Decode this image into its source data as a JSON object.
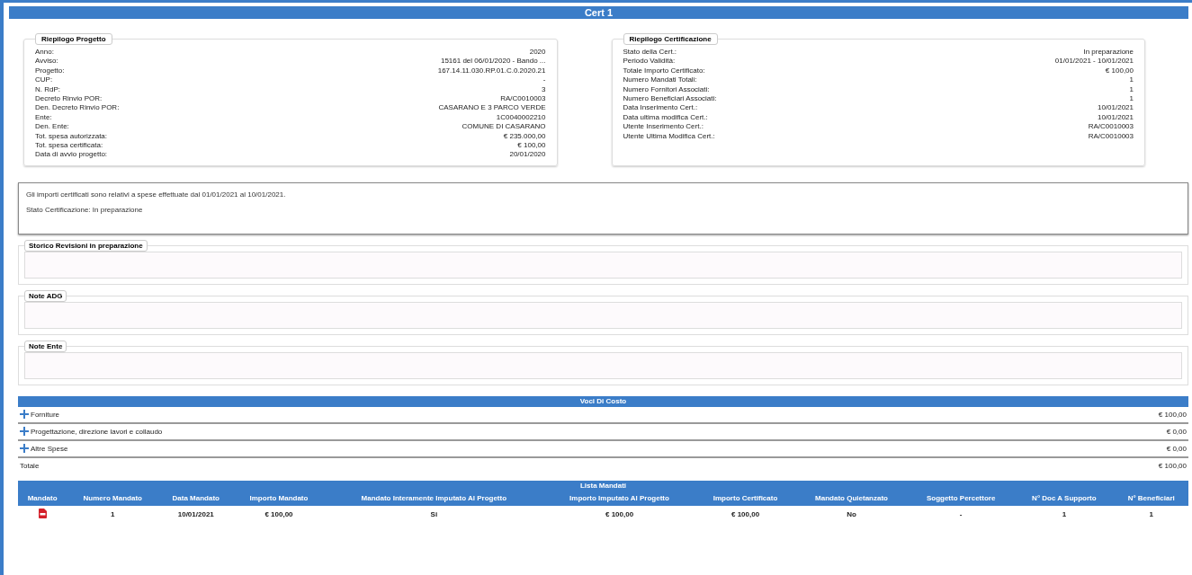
{
  "title": "Cert 1",
  "project_summary": {
    "legend": "Riepilogo Progetto",
    "rows": [
      {
        "label": "Anno:",
        "value": "2020"
      },
      {
        "label": "Avviso:",
        "value": "15161 del 06/01/2020 - Bando ..."
      },
      {
        "label": "Progetto:",
        "value": "167.14.11.030.RP.01.C.0.2020.21"
      },
      {
        "label": "CUP:",
        "value": "-"
      },
      {
        "label": "N. RdP:",
        "value": "3"
      },
      {
        "label": "Decreto Rinvio POR:",
        "value": "RA/C0010003"
      },
      {
        "label": "Den. Decreto Rinvio POR:",
        "value": "CASARANO E 3 PARCO VERDE"
      },
      {
        "label": "Ente:",
        "value": "1C0040002210"
      },
      {
        "label": "Den. Ente:",
        "value": "COMUNE DI CASARANO"
      },
      {
        "label": "Tot. spesa autorizzata:",
        "value": "€ 235.000,00"
      },
      {
        "label": "Tot. spesa certificata:",
        "value": "€ 100,00"
      },
      {
        "label": "Data di avvio progetto:",
        "value": "20/01/2020"
      }
    ]
  },
  "cert_summary": {
    "legend": "Riepilogo Certificazione",
    "rows": [
      {
        "label": "Stato della Cert.:",
        "value": "In preparazione"
      },
      {
        "label": "Periodo Validità:",
        "value": "01/01/2021 - 10/01/2021"
      },
      {
        "label": "Totale Importo Certificato:",
        "value": "€ 100,00"
      },
      {
        "label": "Numero Mandati Totali:",
        "value": "1"
      },
      {
        "label": "Numero Fornitori Associati:",
        "value": "1"
      },
      {
        "label": "Numero Beneficiari Associati:",
        "value": "1"
      },
      {
        "label": "Data Inserimento Cert.:",
        "value": "10/01/2021"
      },
      {
        "label": "Data ultima modifica Cert.:",
        "value": "10/01/2021"
      },
      {
        "label": "Utente Inserimento Cert.:",
        "value": "RA/C0010003"
      },
      {
        "label": "Utente Ultima Modifica Cert.:",
        "value": "RA/C0010003"
      }
    ]
  },
  "message": [
    "Gli importi certificati sono relativi a spese effettuate dal 01/01/2021 al 10/01/2021.",
    "Stato Certificazione: In preparazione"
  ],
  "note_fields": [
    {
      "legend": "Storico Revisioni in preparazione"
    },
    {
      "legend": "Note ADG"
    },
    {
      "legend": "Note Ente"
    }
  ],
  "cost_items": {
    "header": "Voci Di Costo",
    "rows": [
      {
        "label": "Forniture",
        "amount": "€ 100,00",
        "kind": "expandable"
      },
      {
        "label": "Progettazione, direzione lavori e collaudo",
        "amount": "€ 0,00",
        "kind": "expandable"
      },
      {
        "label": "Altre Spese",
        "amount": "€ 0,00",
        "kind": "expandable"
      },
      {
        "label": "Totale",
        "amount": "€ 100,00",
        "kind": "total"
      }
    ]
  },
  "mandates": {
    "header": "Lista Mandati",
    "columns": [
      "Mandato",
      "Numero Mandato",
      "Data Mandato",
      "Importo Mandato",
      "Mandato Interamente Imputato Al Progetto",
      "Importo Imputato Al Progetto",
      "Importo Certificato",
      "Mandato Quietanzato",
      "Soggetto Percettore",
      "N° Doc A Supporto",
      "N° Beneficiari"
    ],
    "rows": [
      [
        "",
        "1",
        "10/01/2021",
        "€ 100,00",
        "Si",
        "€ 100,00",
        "€ 100,00",
        "No",
        "-",
        "1",
        "1"
      ]
    ]
  }
}
